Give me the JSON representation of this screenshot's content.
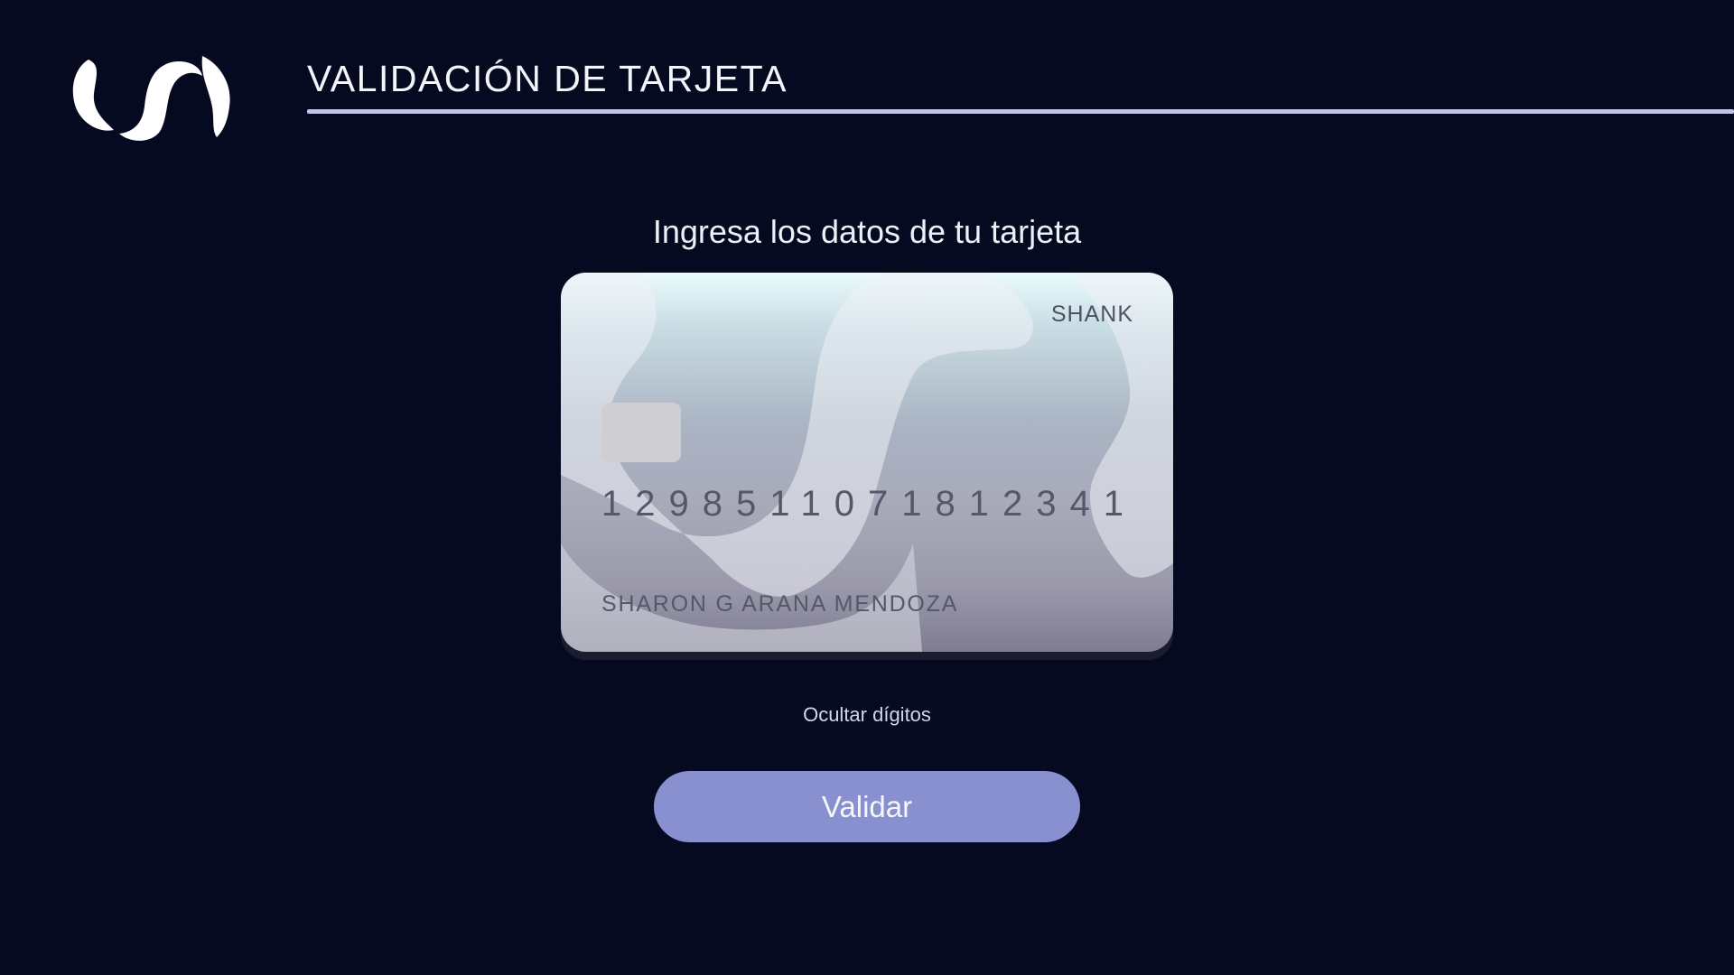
{
  "header": {
    "logo_icon": "brand-swoosh-logo",
    "title": "VALIDACIÓN DE TARJETA",
    "rule_color": "#c4c2ea"
  },
  "main": {
    "subtitle": "Ingresa los datos de tu tarjeta",
    "card": {
      "brand": "SHANK",
      "chip_icon": "chip-icon",
      "number_groups": [
        "1298",
        "5110",
        "7181",
        "2341"
      ],
      "holder_name": "SHARON G ARANA MENDOZA"
    },
    "toggle_digits_label": "Ocultar dígitos",
    "validate_label": "Validar"
  },
  "colors": {
    "background": "#060a20",
    "button": "#8890cf",
    "card_text": "#555869"
  }
}
